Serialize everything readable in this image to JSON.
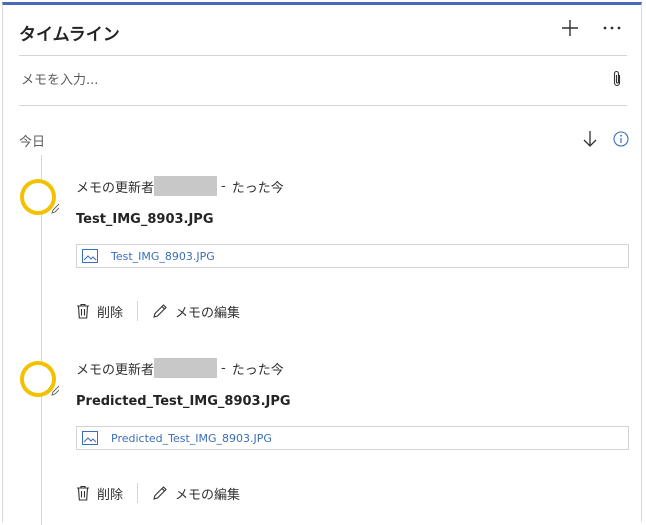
{
  "header": {
    "title": "タイムライン",
    "add_icon": "plus-icon",
    "more_icon": "ellipsis-icon"
  },
  "memo": {
    "placeholder": "メモを入力...",
    "attach_icon": "paperclip-icon"
  },
  "section": {
    "label": "今日",
    "sort_icon": "arrow-down-icon",
    "info_icon": "info-icon"
  },
  "entries": [
    {
      "author_prefix": "メモの更新者",
      "separator": "-",
      "time": "たった今",
      "text": "Test_IMG_8903.JPG",
      "attachment": "Test_IMG_8903.JPG",
      "delete_label": "削除",
      "edit_label": "メモの編集"
    },
    {
      "author_prefix": "メモの更新者",
      "separator": "-",
      "time": "たった今",
      "text": "Predicted_Test_IMG_8903.JPG",
      "attachment": "Predicted_Test_IMG_8903.JPG",
      "delete_label": "削除",
      "edit_label": "メモの編集"
    }
  ],
  "colors": {
    "accent_border": "#4a6ab8",
    "avatar_ring": "#f2c200",
    "link": "#3c6fb8"
  }
}
